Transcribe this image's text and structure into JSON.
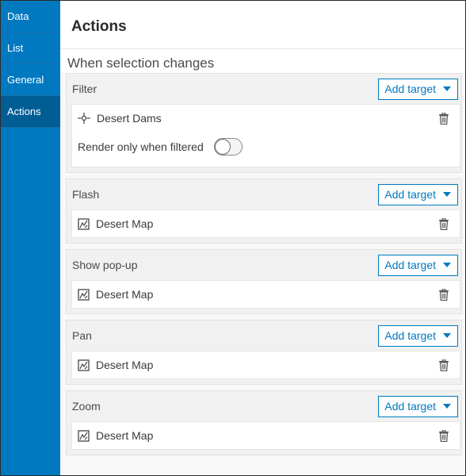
{
  "sidebar": {
    "items": [
      {
        "label": "Data"
      },
      {
        "label": "List"
      },
      {
        "label": "General"
      },
      {
        "label": "Actions"
      }
    ],
    "active_index": 3
  },
  "header": {
    "title": "Actions"
  },
  "section": {
    "heading": "When selection changes"
  },
  "actions": [
    {
      "label": "Filter",
      "button": "Add target",
      "target": "Desert Dams",
      "target_icon": "point-layer-icon",
      "render_label": "Render only when filtered",
      "render_on": false
    },
    {
      "label": "Flash",
      "button": "Add target",
      "target": "Desert Map",
      "target_icon": "map-icon"
    },
    {
      "label": "Show pop-up",
      "button": "Add target",
      "target": "Desert Map",
      "target_icon": "map-icon"
    },
    {
      "label": "Pan",
      "button": "Add target",
      "target": "Desert Map",
      "target_icon": "map-icon"
    },
    {
      "label": "Zoom",
      "button": "Add target",
      "target": "Desert Map",
      "target_icon": "map-icon"
    }
  ],
  "colors": {
    "accent": "#0079c1",
    "sidebar_active": "#005e95"
  }
}
